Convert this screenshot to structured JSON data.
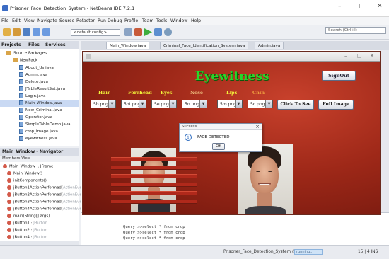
{
  "ide": {
    "title": "Prisoner_Face_Detection_System - NetBeans IDE 7.2.1",
    "window_controls": [
      "–",
      "□",
      "✕"
    ],
    "menu": [
      "File",
      "Edit",
      "View",
      "Navigate",
      "Source",
      "Refactor",
      "Run",
      "Debug",
      "Profile",
      "Team",
      "Tools",
      "Window",
      "Help"
    ],
    "config_select": "<default config>",
    "search_placeholder": "Search (Ctrl+I)"
  },
  "projects_panel": {
    "tabs": [
      "Projects",
      "Files",
      "Services"
    ],
    "tree": [
      {
        "label": "Source Packages",
        "kind": "pkg",
        "indent": 1
      },
      {
        "label": "NewPack",
        "kind": "pkg",
        "indent": 2
      },
      {
        "label": "About_Us.java",
        "kind": "file",
        "indent": 3
      },
      {
        "label": "Admin.java",
        "kind": "file",
        "indent": 3
      },
      {
        "label": "Delete.java",
        "kind": "file",
        "indent": 3
      },
      {
        "label": "JTableResultSet.java",
        "kind": "file",
        "indent": 3
      },
      {
        "label": "Login.java",
        "kind": "file",
        "indent": 3
      },
      {
        "label": "Main_Window.java",
        "kind": "file",
        "indent": 3,
        "selected": true
      },
      {
        "label": "New_Criminal.java",
        "kind": "file",
        "indent": 3
      },
      {
        "label": "Operator.java",
        "kind": "file",
        "indent": 3
      },
      {
        "label": "SimpleTableDemo.java",
        "kind": "file",
        "indent": 3
      },
      {
        "label": "crop_image.java",
        "kind": "file",
        "indent": 3
      },
      {
        "label": "eyewitness.java",
        "kind": "file",
        "indent": 3
      }
    ]
  },
  "navigator": {
    "header": "Main_Window - Navigator",
    "subheader": "Members View",
    "items": [
      {
        "label": "Main_Window :: JFrame",
        "muted": ""
      },
      {
        "label": "Main_Window()",
        "muted": ""
      },
      {
        "label": "initComponents()",
        "muted": ""
      },
      {
        "label": "jButton1ActionPerformed(",
        "muted": "ActionEvent"
      },
      {
        "label": "jButton2ActionPerformed(",
        "muted": "ActionEvent"
      },
      {
        "label": "jButton3ActionPerformed(",
        "muted": "ActionEvent"
      },
      {
        "label": "jButton4ActionPerformed(",
        "muted": "ActionEvent"
      },
      {
        "label": "main(String[] args)",
        "muted": ""
      },
      {
        "label": "jButton1 : ",
        "muted": "JButton"
      },
      {
        "label": "jButton2 : ",
        "muted": "JButton"
      },
      {
        "label": "jButton4 : ",
        "muted": "JButton"
      }
    ]
  },
  "editor_tabs": [
    {
      "label": "Main_Window.java",
      "active": true
    },
    {
      "label": "Criminal_Face_Identification_System.java",
      "active": false
    },
    {
      "label": "Admin.java",
      "active": false
    }
  ],
  "output_lines": [
    "Query   >>select * from crop",
    "Query   >>select * from crop",
    "Query   >>select * from crop"
  ],
  "status": {
    "project": "Prisoner_Face_Detection_System (run)",
    "running": "running...",
    "position": "15 | 4   INS"
  },
  "app": {
    "heading": "Eyewitness",
    "signout_label": "SignOut",
    "features": [
      {
        "label": "Hair",
        "value": "5h.png",
        "color": "#f2f23a"
      },
      {
        "label": "Forehead",
        "value": "5ht.png",
        "color": "#f2f23a"
      },
      {
        "label": "Eyes",
        "value": "5e.png",
        "color": "#f2f23a"
      },
      {
        "label": "Nose",
        "value": "5n.png",
        "color": "#f0c080"
      },
      {
        "label": "Lips",
        "value": "5m.png",
        "color": "#f2f23a"
      },
      {
        "label": "Chin",
        "value": "5c.png",
        "color": "#f0a040"
      }
    ],
    "click_to_see_label": "Click To See",
    "full_image_label": "Full Image"
  },
  "dialog": {
    "title": "Success",
    "message": "FACE DETECTED",
    "ok_label": "OK",
    "close_glyph": "×",
    "info_glyph": "i"
  }
}
